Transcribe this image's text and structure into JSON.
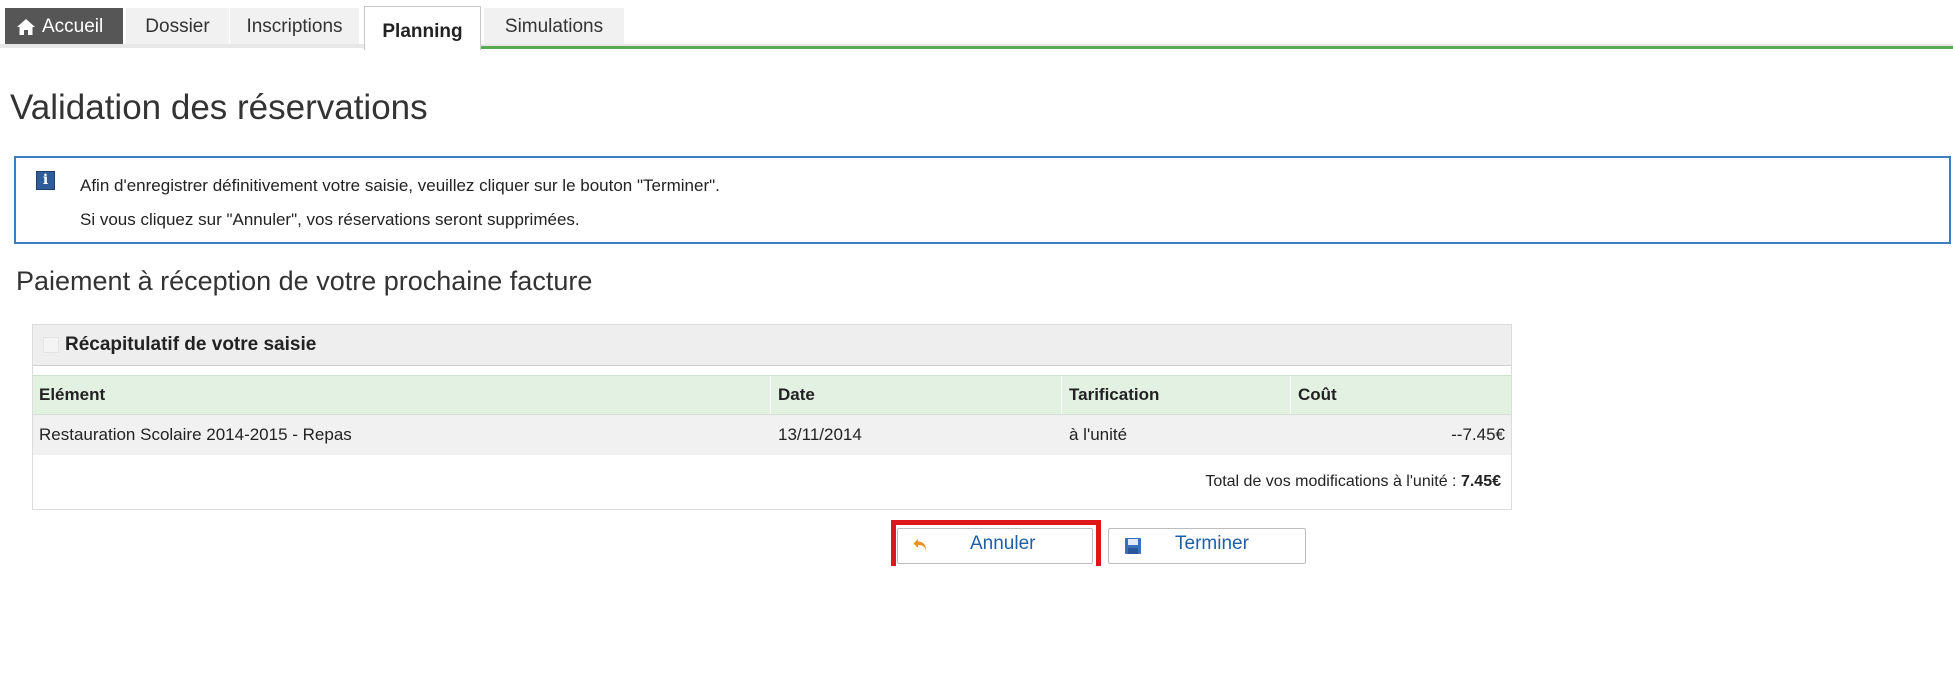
{
  "tabs": [
    {
      "label": "Accueil",
      "icon": "home-icon",
      "active": false
    },
    {
      "label": "Dossier",
      "active": false
    },
    {
      "label": "Inscriptions",
      "active": false
    },
    {
      "label": "Planning",
      "active": true
    },
    {
      "label": "Simulations",
      "active": false
    }
  ],
  "page": {
    "title": "Validation des réservations"
  },
  "info": {
    "icon": "info-icon",
    "line1": "Afin d'enregistrer définitivement votre saisie, veuillez cliquer sur le bouton \"Terminer\".",
    "line2": "Si vous cliquez sur \"Annuler\", vos réservations seront supprimées."
  },
  "section": {
    "heading": "Paiement à réception de votre prochaine facture"
  },
  "summary": {
    "title": "Récapitulatif de votre saisie",
    "columns": [
      "Elément",
      "Date",
      "Tarification",
      "Coût"
    ],
    "rows": [
      {
        "element": "Restauration Scolaire 2014-2015 - Repas",
        "date": "13/11/2014",
        "tarification": "à l'unité",
        "cout": "--7.45€"
      }
    ],
    "total_label": "Total de vos modifications à l'unité : ",
    "total_value": "7.45€"
  },
  "buttons": {
    "cancel_label": "Annuler",
    "cancel_icon": "undo-icon",
    "finish_label": "Terminer",
    "finish_icon": "save-icon"
  },
  "colors": {
    "accent_green": "#57a954",
    "info_border": "#3d7ebf",
    "link_blue": "#1f5fa8",
    "highlight_red": "#e0161d"
  }
}
